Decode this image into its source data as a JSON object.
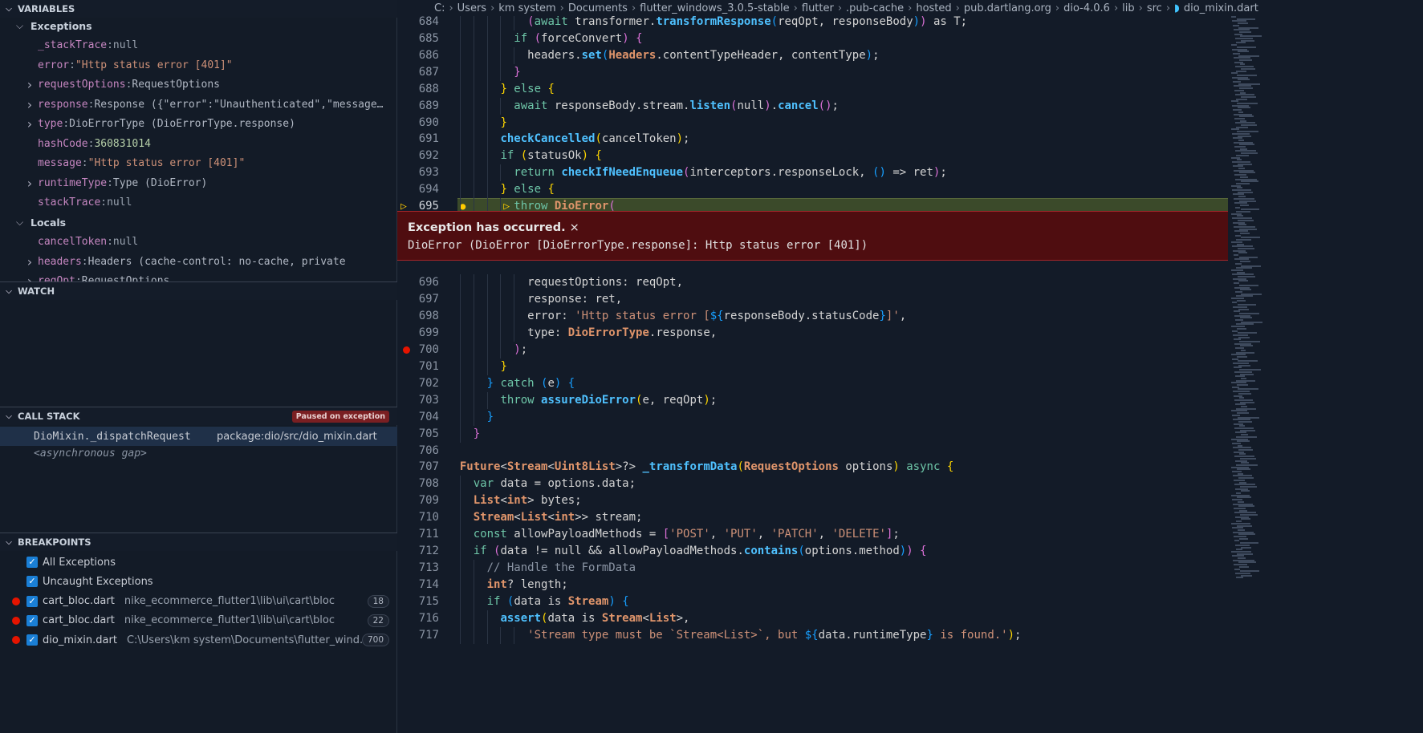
{
  "variables": {
    "title": "VARIABLES",
    "groups": [
      {
        "label": "Exceptions",
        "items": [
          {
            "name": "_stackTrace",
            "value": "null",
            "type": "null",
            "expandable": false
          },
          {
            "name": "error",
            "value": "\"Http status error [401]\"",
            "type": "str",
            "expandable": false
          },
          {
            "name": "requestOptions",
            "value": "RequestOptions",
            "type": "obj",
            "expandable": true
          },
          {
            "name": "response",
            "value": "Response ({\"error\":\"Unauthenticated\",\"message…",
            "type": "obj",
            "expandable": true
          },
          {
            "name": "type",
            "value": "DioErrorType (DioErrorType.response)",
            "type": "obj",
            "expandable": true
          },
          {
            "name": "hashCode",
            "value": "360831014",
            "type": "num",
            "expandable": false
          },
          {
            "name": "message",
            "value": "\"Http status error [401]\"",
            "type": "str",
            "expandable": false
          },
          {
            "name": "runtimeType",
            "value": "Type (DioError)",
            "type": "obj",
            "expandable": true
          },
          {
            "name": "stackTrace",
            "value": "null",
            "type": "null",
            "expandable": false
          }
        ]
      },
      {
        "label": "Locals",
        "items": [
          {
            "name": "cancelToken",
            "value": "null",
            "type": "null",
            "expandable": false
          },
          {
            "name": "headers",
            "value": "Headers (cache-control: no-cache, private",
            "type": "obj",
            "expandable": true
          },
          {
            "name": "reqOpt",
            "value": "RequestOptions",
            "type": "obj",
            "expandable": true
          }
        ]
      }
    ]
  },
  "watch": {
    "title": "WATCH"
  },
  "call_stack": {
    "title": "CALL STACK",
    "badge": "Paused on exception",
    "frames": [
      {
        "name": "DioMixin._dispatchRequest",
        "source": "package:dio/src/dio_mixin.dart"
      }
    ],
    "gap": "<asynchronous gap>"
  },
  "breakpoints": {
    "title": "BREAKPOINTS",
    "items": [
      {
        "label": "All Exceptions",
        "path": "",
        "line": "",
        "dot": false
      },
      {
        "label": "Uncaught Exceptions",
        "path": "",
        "line": "",
        "dot": false
      },
      {
        "label": "cart_bloc.dart",
        "path": "nike_ecommerce_flutter1\\lib\\ui\\cart\\bloc",
        "line": "18",
        "dot": true
      },
      {
        "label": "cart_bloc.dart",
        "path": "nike_ecommerce_flutter1\\lib\\ui\\cart\\bloc",
        "line": "22",
        "dot": true
      },
      {
        "label": "dio_mixin.dart",
        "path": "C:\\Users\\km system\\Documents\\flutter_wind...",
        "line": "700",
        "dot": true
      }
    ]
  },
  "breadcrumb": [
    "C:",
    "Users",
    "km system",
    "Documents",
    "flutter_windows_3.0.5-stable",
    "flutter",
    ".pub-cache",
    "hosted",
    "pub.dartlang.org",
    "dio-4.0.6",
    "lib",
    "src",
    "dio_mixin.dart"
  ],
  "exception": {
    "title": "Exception has occurred.",
    "close": "×",
    "message": "DioError (DioError [DioErrorType.response]: Http status error [401])"
  },
  "colors": {
    "accent": "#1a7fd6",
    "breakpoint": "#e51400",
    "exception_bg": "#4f0d10",
    "current_line": "#3b4a2a"
  },
  "editor": {
    "current_line": 695,
    "breakpoint_line": 700,
    "lines": [
      {
        "n": 684,
        "i": 12,
        "t": [
          [
            "b2",
            "("
          ],
          [
            "k",
            "await "
          ],
          [
            "p",
            "transformer."
          ],
          [
            "f",
            "transformResponse"
          ],
          [
            "b3",
            "("
          ],
          [
            "p",
            "reqOpt, responseBody"
          ],
          [
            "b3",
            ")"
          ],
          [
            "b2",
            ")"
          ],
          [
            "p",
            " as T;"
          ]
        ]
      },
      {
        "n": 685,
        "i": 10,
        "t": [
          [
            "k",
            "if "
          ],
          [
            "b2",
            "("
          ],
          [
            "p",
            "forceConvert"
          ],
          [
            "b2",
            ")"
          ],
          [
            "p",
            " "
          ],
          [
            "b2",
            "{"
          ]
        ]
      },
      {
        "n": 686,
        "i": 12,
        "t": [
          [
            "p",
            "headers."
          ],
          [
            "f",
            "set"
          ],
          [
            "b3",
            "("
          ],
          [
            "c",
            "Headers"
          ],
          [
            "p",
            ".contentTypeHeader, contentType"
          ],
          [
            "b3",
            ")"
          ],
          [
            "p",
            ";"
          ]
        ]
      },
      {
        "n": 687,
        "i": 10,
        "t": [
          [
            "b2",
            "}"
          ]
        ]
      },
      {
        "n": 688,
        "i": 8,
        "t": [
          [
            "b1",
            "}"
          ],
          [
            "k",
            " else "
          ],
          [
            "b1",
            "{"
          ]
        ]
      },
      {
        "n": 689,
        "i": 10,
        "t": [
          [
            "k",
            "await "
          ],
          [
            "p",
            "responseBody.stream."
          ],
          [
            "f",
            "listen"
          ],
          [
            "b2",
            "("
          ],
          [
            "p",
            "null"
          ],
          [
            "b2",
            ")"
          ],
          [
            "p",
            "."
          ],
          [
            "f",
            "cancel"
          ],
          [
            "b2",
            "()"
          ],
          [
            "p",
            ";"
          ]
        ]
      },
      {
        "n": 690,
        "i": 8,
        "t": [
          [
            "b1",
            "}"
          ]
        ]
      },
      {
        "n": 691,
        "i": 8,
        "t": [
          [
            "f",
            "checkCancelled"
          ],
          [
            "b1",
            "("
          ],
          [
            "p",
            "cancelToken"
          ],
          [
            "b1",
            ")"
          ],
          [
            "p",
            ";"
          ]
        ]
      },
      {
        "n": 692,
        "i": 8,
        "t": [
          [
            "k",
            "if "
          ],
          [
            "b1",
            "("
          ],
          [
            "p",
            "statusOk"
          ],
          [
            "b1",
            ")"
          ],
          [
            "p",
            " "
          ],
          [
            "b1",
            "{"
          ]
        ]
      },
      {
        "n": 693,
        "i": 10,
        "t": [
          [
            "k",
            "return "
          ],
          [
            "f",
            "checkIfNeedEnqueue"
          ],
          [
            "b2",
            "("
          ],
          [
            "p",
            "interceptors.responseLock, "
          ],
          [
            "b3",
            "()"
          ],
          [
            "p",
            " => ret"
          ],
          [
            "b2",
            ")"
          ],
          [
            "p",
            ";"
          ]
        ]
      },
      {
        "n": 694,
        "i": 8,
        "t": [
          [
            "b1",
            "}"
          ],
          [
            "k",
            " else "
          ],
          [
            "b1",
            "{"
          ]
        ]
      },
      {
        "n": 695,
        "i": 10,
        "t": [
          [
            "k",
            "throw "
          ],
          [
            "c",
            "DioError"
          ],
          [
            "b2",
            "("
          ]
        ]
      },
      {
        "n": 696,
        "i": 12,
        "t": [
          [
            "p",
            "requestOptions: reqOpt,"
          ]
        ]
      },
      {
        "n": 697,
        "i": 12,
        "t": [
          [
            "p",
            "response: ret,"
          ]
        ]
      },
      {
        "n": 698,
        "i": 12,
        "t": [
          [
            "p",
            "error: "
          ],
          [
            "s",
            "'Http status error ["
          ],
          [
            "b3",
            "${"
          ],
          [
            "p",
            "responseBody.statusCode"
          ],
          [
            "b3",
            "}"
          ],
          [
            "s",
            "]'"
          ],
          [
            "p",
            ","
          ]
        ]
      },
      {
        "n": 699,
        "i": 12,
        "t": [
          [
            "p",
            "type: "
          ],
          [
            "c",
            "DioErrorType"
          ],
          [
            "p",
            ".response,"
          ]
        ]
      },
      {
        "n": 700,
        "i": 10,
        "t": [
          [
            "b2",
            ")"
          ],
          [
            "p",
            ";"
          ]
        ]
      },
      {
        "n": 701,
        "i": 8,
        "t": [
          [
            "b1",
            "}"
          ]
        ]
      },
      {
        "n": 702,
        "i": 6,
        "t": [
          [
            "b3",
            "}"
          ],
          [
            "k",
            " catch "
          ],
          [
            "b3",
            "("
          ],
          [
            "p",
            "e"
          ],
          [
            "b3",
            ")"
          ],
          [
            "p",
            " "
          ],
          [
            "b3",
            "{"
          ]
        ]
      },
      {
        "n": 703,
        "i": 8,
        "t": [
          [
            "k",
            "throw "
          ],
          [
            "f",
            "assureDioError"
          ],
          [
            "b1",
            "("
          ],
          [
            "p",
            "e, reqOpt"
          ],
          [
            "b1",
            ")"
          ],
          [
            "p",
            ";"
          ]
        ]
      },
      {
        "n": 704,
        "i": 6,
        "t": [
          [
            "b3",
            "}"
          ]
        ]
      },
      {
        "n": 705,
        "i": 4,
        "t": [
          [
            "b2",
            "}"
          ]
        ]
      },
      {
        "n": 706,
        "i": 0,
        "t": []
      },
      {
        "n": 707,
        "i": 2,
        "t": [
          [
            "c",
            "Future"
          ],
          [
            "p",
            "<"
          ],
          [
            "c",
            "Stream"
          ],
          [
            "p",
            "<"
          ],
          [
            "c",
            "Uint8List"
          ],
          [
            "p",
            ">?> "
          ],
          [
            "f",
            "_transformData"
          ],
          [
            "b1",
            "("
          ],
          [
            "c",
            "RequestOptions"
          ],
          [
            "p",
            " options"
          ],
          [
            "b1",
            ")"
          ],
          [
            "k",
            " async "
          ],
          [
            "b1",
            "{"
          ]
        ]
      },
      {
        "n": 708,
        "i": 4,
        "t": [
          [
            "k",
            "var "
          ],
          [
            "p",
            "data = options.data;"
          ]
        ]
      },
      {
        "n": 709,
        "i": 4,
        "t": [
          [
            "c",
            "List"
          ],
          [
            "p",
            "<"
          ],
          [
            "c",
            "int"
          ],
          [
            "p",
            "> bytes;"
          ]
        ]
      },
      {
        "n": 710,
        "i": 4,
        "t": [
          [
            "c",
            "Stream"
          ],
          [
            "p",
            "<"
          ],
          [
            "c",
            "List"
          ],
          [
            "p",
            "<"
          ],
          [
            "c",
            "int"
          ],
          [
            "p",
            ">> stream;"
          ]
        ]
      },
      {
        "n": 711,
        "i": 4,
        "t": [
          [
            "k",
            "const "
          ],
          [
            "p",
            "allowPayloadMethods = "
          ],
          [
            "b2",
            "["
          ],
          [
            "s",
            "'POST'"
          ],
          [
            "p",
            ", "
          ],
          [
            "s",
            "'PUT'"
          ],
          [
            "p",
            ", "
          ],
          [
            "s",
            "'PATCH'"
          ],
          [
            "p",
            ", "
          ],
          [
            "s",
            "'DELETE'"
          ],
          [
            "b2",
            "]"
          ],
          [
            "p",
            ";"
          ]
        ]
      },
      {
        "n": 712,
        "i": 4,
        "t": [
          [
            "k",
            "if "
          ],
          [
            "b2",
            "("
          ],
          [
            "p",
            "data != null && allowPayloadMethods."
          ],
          [
            "f",
            "contains"
          ],
          [
            "b3",
            "("
          ],
          [
            "p",
            "options.method"
          ],
          [
            "b3",
            ")"
          ],
          [
            "b2",
            ")"
          ],
          [
            "p",
            " "
          ],
          [
            "b2",
            "{"
          ]
        ]
      },
      {
        "n": 713,
        "i": 6,
        "t": [
          [
            "cm",
            "// Handle the FormData"
          ]
        ]
      },
      {
        "n": 714,
        "i": 6,
        "t": [
          [
            "c",
            "int"
          ],
          [
            "p",
            "? length;"
          ]
        ]
      },
      {
        "n": 715,
        "i": 6,
        "t": [
          [
            "k",
            "if "
          ],
          [
            "b3",
            "("
          ],
          [
            "p",
            "data is "
          ],
          [
            "c",
            "Stream"
          ],
          [
            "b3",
            ")"
          ],
          [
            "p",
            " "
          ],
          [
            "b3",
            "{"
          ]
        ]
      },
      {
        "n": 716,
        "i": 8,
        "t": [
          [
            "f",
            "assert"
          ],
          [
            "b1",
            "("
          ],
          [
            "p",
            "data is "
          ],
          [
            "c",
            "Stream"
          ],
          [
            "p",
            "<"
          ],
          [
            "c",
            "List"
          ],
          [
            "p",
            ">,"
          ]
        ]
      },
      {
        "n": 717,
        "i": 12,
        "t": [
          [
            "s",
            "'Stream type must be `Stream<List>`, but "
          ],
          [
            "b3",
            "${"
          ],
          [
            "p",
            "data.runtimeType"
          ],
          [
            "b3",
            "}"
          ],
          [
            "s",
            " is found.'"
          ],
          [
            "b1",
            ")"
          ],
          [
            "p",
            ";"
          ]
        ]
      }
    ]
  }
}
